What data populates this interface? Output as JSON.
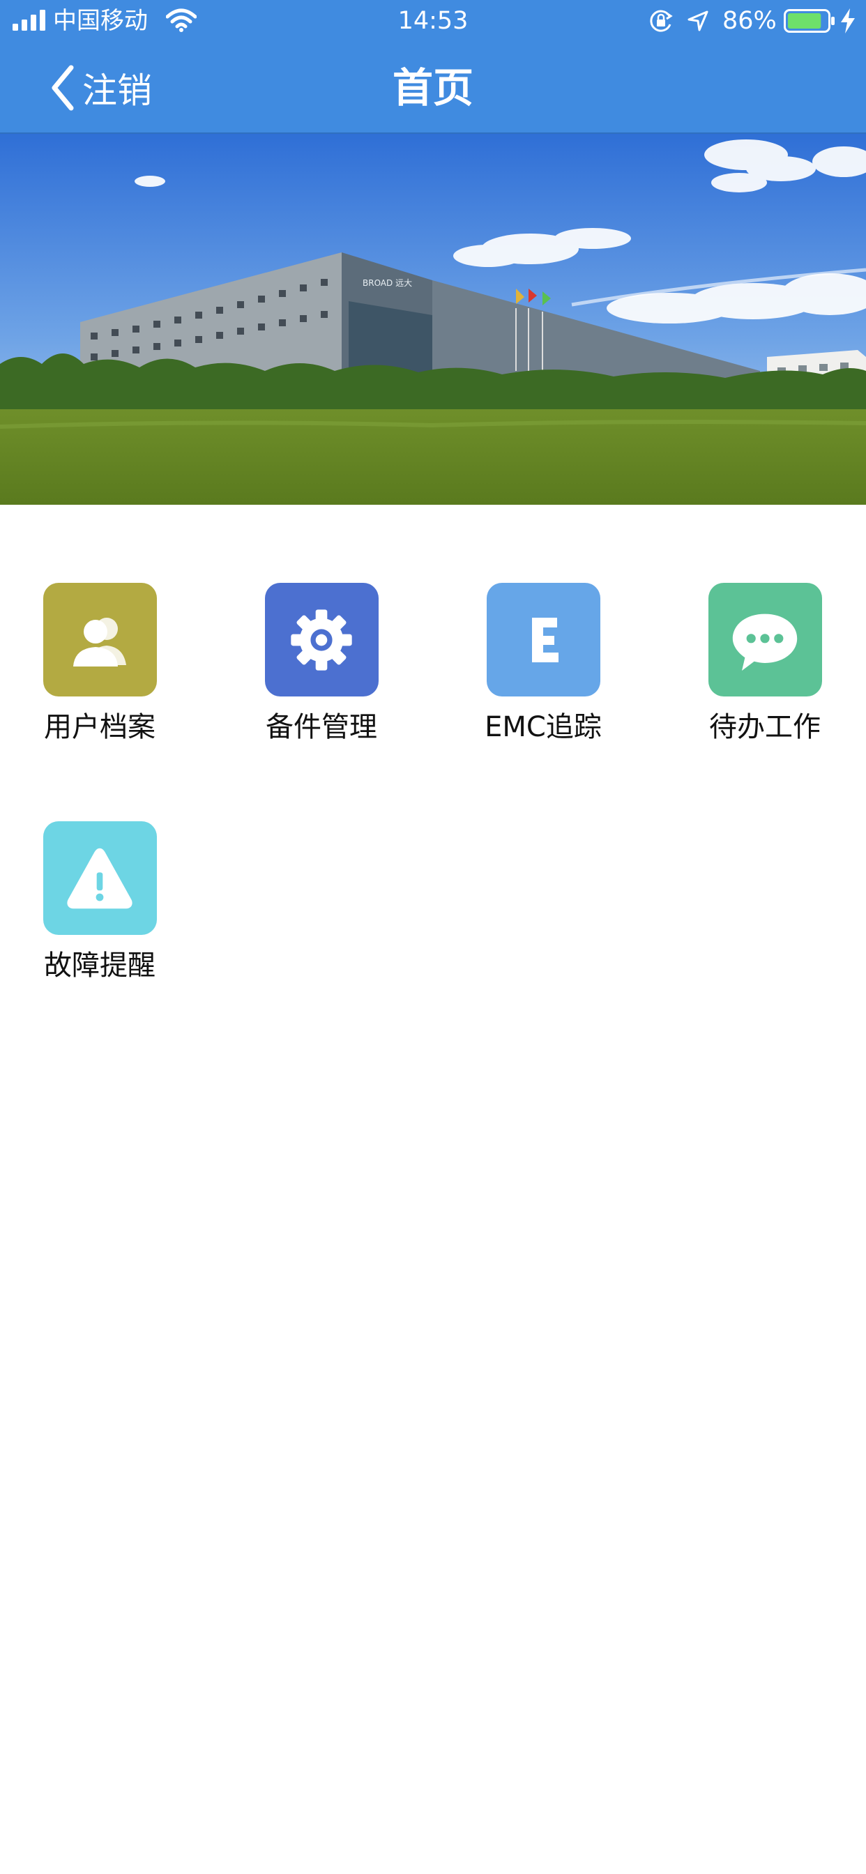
{
  "status_bar": {
    "carrier": "中国移动",
    "time": "14:53",
    "battery_percent": "86%",
    "battery_level": 0.86
  },
  "nav": {
    "back_label": "注销",
    "title": "首页"
  },
  "banner": {
    "sign_text": "BROAD 远大"
  },
  "menu": [
    {
      "label": "用户档案",
      "icon": "user-profile-icon",
      "color": "#b3aa42"
    },
    {
      "label": "备件管理",
      "icon": "gear-icon",
      "color": "#4c70d0"
    },
    {
      "label": "EMC追踪",
      "icon": "letter-e-icon",
      "color": "#66a6e8"
    },
    {
      "label": "待办工作",
      "icon": "chat-bubble-icon",
      "color": "#5cc296"
    },
    {
      "label": "故障提醒",
      "icon": "warning-icon",
      "color": "#6dd5e4"
    }
  ],
  "colors": {
    "nav_bar": "#408be0"
  }
}
